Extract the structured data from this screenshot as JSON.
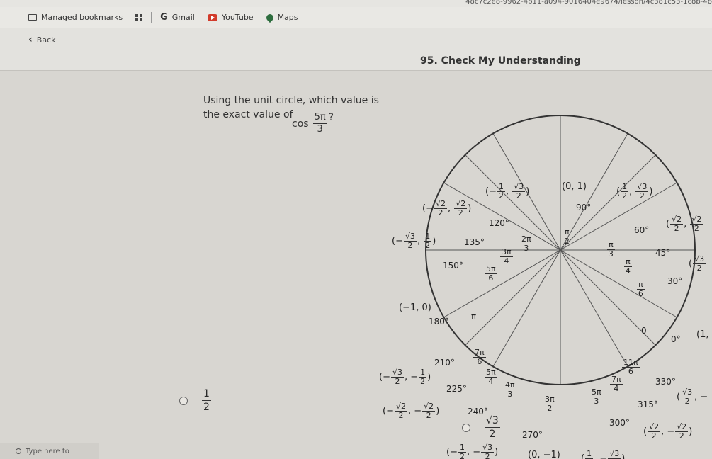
{
  "browser": {
    "url_fragment": "48c7c2e8-9962-4b11-a094-9016404e9674/lesson/4c381c53-1c8b-4b",
    "bookmarks": [
      {
        "label": "Managed bookmarks",
        "icon": "folder-icon"
      },
      {
        "label": "",
        "icon": "apps-grid-icon"
      },
      {
        "label": "Gmail",
        "icon": "google-g-icon"
      },
      {
        "label": "YouTube",
        "icon": "youtube-icon"
      },
      {
        "label": "Maps",
        "icon": "maps-pin-icon"
      }
    ]
  },
  "header": {
    "back_label": "Back",
    "title": "95. Check My Understanding"
  },
  "question": {
    "line1": "Using the unit circle, which value is",
    "line2": "the exact value of",
    "func": "cos",
    "num": "5π",
    "den": "3",
    "qmark": "?"
  },
  "unit_circle": {
    "angles": {
      "deg_0": "0°",
      "deg_30": "30°",
      "deg_45": "45°",
      "deg_60": "60°",
      "deg_90": "90°",
      "deg_120": "120°",
      "deg_135": "135°",
      "deg_150": "150°",
      "deg_180": "180°",
      "deg_210": "210°",
      "deg_225": "225°",
      "deg_240": "240°",
      "deg_270": "270°",
      "deg_300": "300°",
      "deg_315": "315°",
      "deg_330": "330°"
    },
    "radians": {
      "r0": "0",
      "r_pi": "π",
      "pi6_n": "π",
      "pi6_d": "6",
      "pi4_n": "π",
      "pi4_d": "4",
      "pi3_n": "π",
      "pi3_d": "3",
      "pi2_n": "π",
      "pi2_d": "2",
      "r2pi3_n": "2π",
      "r2pi3_d": "3",
      "r3pi4_n": "3π",
      "r3pi4_d": "4",
      "r5pi6_n": "5π",
      "r5pi6_d": "6",
      "r7pi6_n": "7π",
      "r7pi6_d": "6",
      "r5pi4_n": "5π",
      "r5pi4_d": "4",
      "r4pi3_n": "4π",
      "r4pi3_d": "3",
      "r3pi2_n": "3π",
      "r3pi2_d": "2",
      "r5pi3_n": "5π",
      "r5pi3_d": "3",
      "r7pi4_n": "7π",
      "r7pi4_d": "4",
      "r11pi6_n": "11π",
      "r11pi6_d": "6"
    },
    "coords": {
      "c90": "(0, 1)",
      "c180": "(−1, 0)",
      "c0": "(1, (",
      "c270": "(0, −1)",
      "half": "1",
      "two": "2",
      "s3": "√3",
      "s2": "√2",
      "neg": "−"
    }
  },
  "options": [
    {
      "num": "1",
      "den": "2"
    },
    {
      "num": "√3",
      "den": "2"
    }
  ],
  "taskbar": {
    "search_placeholder": "Type here to"
  }
}
